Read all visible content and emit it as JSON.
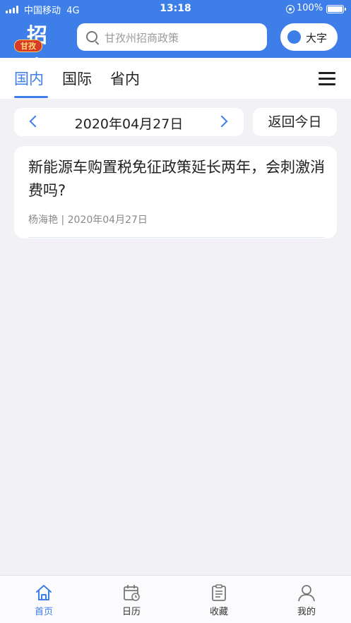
{
  "status_bar": {
    "carrier": "中国移动",
    "network": "4G",
    "time": "13:18",
    "battery": "100%"
  },
  "header": {
    "logo_main": "招商",
    "logo_badge": "甘孜",
    "search_placeholder": "甘孜州招商政策",
    "font_toggle_label": "大字",
    "accent_color": "#3d7ee8"
  },
  "tabs": [
    {
      "label": "国内",
      "active": true
    },
    {
      "label": "国际",
      "active": false
    },
    {
      "label": "省内",
      "active": false
    }
  ],
  "date_nav": {
    "date": "2020年04月27日",
    "today_label": "返回今日"
  },
  "articles": [
    {
      "title": "新能源车购置税免征政策延长两年，会刺激消费吗?",
      "author": "杨海艳",
      "separator": "|",
      "date": "2020年04月27日"
    }
  ],
  "bottom_nav": [
    {
      "label": "首页",
      "icon": "home-icon",
      "active": true
    },
    {
      "label": "日历",
      "icon": "calendar-icon",
      "active": false
    },
    {
      "label": "收藏",
      "icon": "clipboard-icon",
      "active": false
    },
    {
      "label": "我的",
      "icon": "user-icon",
      "active": false
    }
  ]
}
